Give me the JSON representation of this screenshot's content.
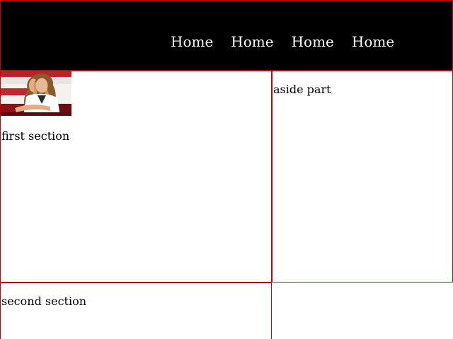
{
  "nav": {
    "items": [
      {
        "label": "Home"
      },
      {
        "label": "Home"
      },
      {
        "label": "Home"
      },
      {
        "label": "Home"
      }
    ]
  },
  "first_section": {
    "image_alt": "",
    "text": "first section"
  },
  "aside": {
    "text": "aside part"
  },
  "second_section": {
    "text": "second section"
  },
  "colors": {
    "header_bg": "#000000",
    "border": "#cc0000",
    "nav_text": "#ffffff"
  }
}
